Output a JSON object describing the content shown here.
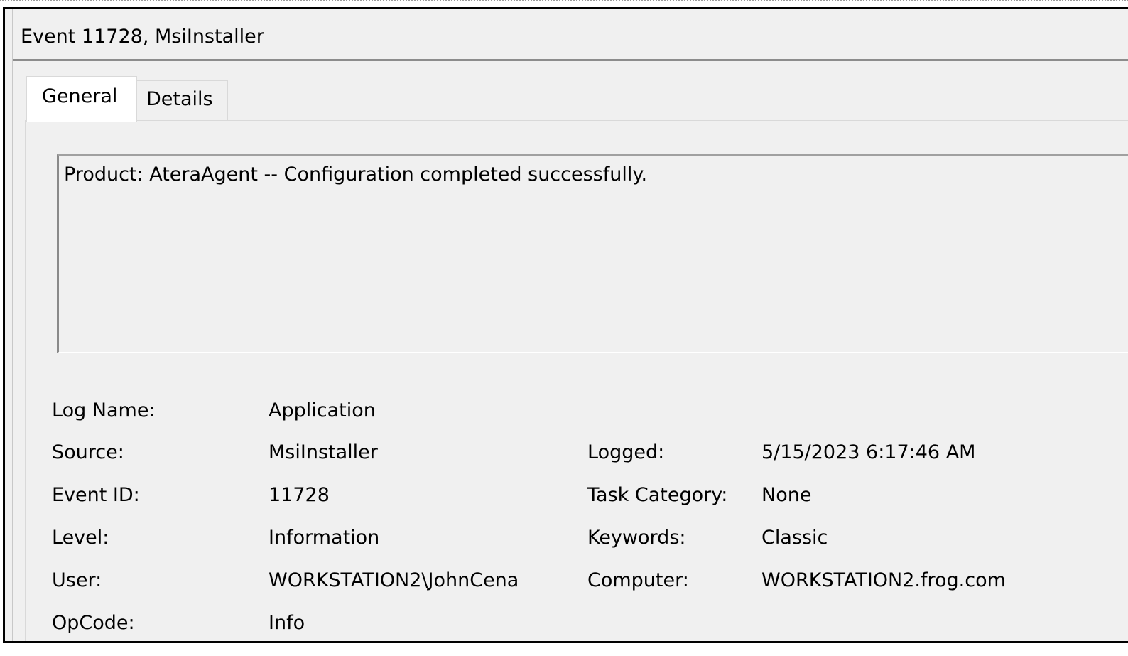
{
  "window": {
    "title": "Event 11728, MsiInstaller"
  },
  "tabs": [
    {
      "label": "General",
      "selected": true
    },
    {
      "label": "Details",
      "selected": false
    }
  ],
  "message": "Product: AteraAgent -- Configuration completed successfully.",
  "fields": {
    "log_name": {
      "label": "Log Name:",
      "value": "Application"
    },
    "source": {
      "label": "Source:",
      "value": "MsiInstaller"
    },
    "logged": {
      "label": "Logged:",
      "value": "5/15/2023 6:17:46 AM"
    },
    "event_id": {
      "label": "Event ID:",
      "value": "11728"
    },
    "task_category": {
      "label": "Task Category:",
      "value": "None"
    },
    "level": {
      "label": "Level:",
      "value": "Information"
    },
    "keywords": {
      "label": "Keywords:",
      "value": "Classic"
    },
    "user": {
      "label": "User:",
      "value": "WORKSTATION2\\JohnCena"
    },
    "computer": {
      "label": "Computer:",
      "value": "WORKSTATION2.frog.com"
    },
    "opcode": {
      "label": "OpCode:",
      "value": "Info"
    }
  },
  "colors": {
    "window_background": "#f0f0f0",
    "outer_border": "#000000",
    "separator": "#8c8c8c",
    "tab_selected_background": "#ffffff"
  }
}
